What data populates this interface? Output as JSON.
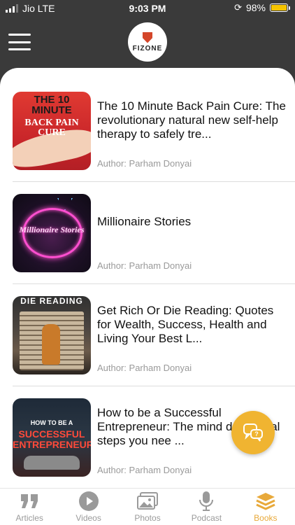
{
  "status_bar": {
    "carrier": "Jio LTE",
    "time": "9:03 PM",
    "battery": "98%",
    "battery_level": 0.98
  },
  "header": {
    "logo_text": "FIZONE"
  },
  "books": [
    {
      "title": "The 10 Minute Back Pain Cure: The revolutionary natural new self-help therapy to safely tre...",
      "author": "Author: Parham Donyai",
      "cover_line1": "THE 10 MINUTE",
      "cover_line2": "BACK PAIN CURE"
    },
    {
      "title": "Millionaire Stories",
      "author": "Author: Parham Donyai",
      "cover_line1": "Millionaire Stories"
    },
    {
      "title": "Get Rich Or Die Reading: Quotes for Wealth, Success, Health and Living Your Best L...",
      "author": "Author: Parham Donyai",
      "cover_line1": "DIE READING"
    },
    {
      "title": "How to be a Successful Entrepreneur: The mind d practical steps you nee ...",
      "author": "Author: Parham Donyai",
      "cover_line1": "HOW TO BE A",
      "cover_line2": "SUCCESSFUL ENTREPRENEUR"
    }
  ],
  "tabs": [
    {
      "label": "Articles",
      "icon": "quote-icon"
    },
    {
      "label": "Videos",
      "icon": "play-icon"
    },
    {
      "label": "Photos",
      "icon": "photos-icon"
    },
    {
      "label": "Podcast",
      "icon": "microphone-icon"
    },
    {
      "label": "Books",
      "icon": "books-icon",
      "active": true
    }
  ],
  "colors": {
    "accent": "#e8a93a",
    "fab": "#f0b431",
    "header_bg": "#3a3a3a"
  }
}
